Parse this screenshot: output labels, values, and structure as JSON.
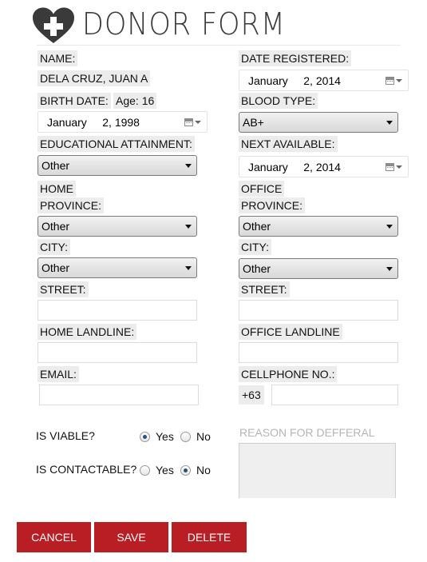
{
  "header": {
    "title": "DONOR FORM",
    "logo_icon": "heart-plus-icon",
    "accent": "#3a3a3a"
  },
  "left": {
    "name_label": "NAME:",
    "name_value": "DELA CRUZ, JUAN A",
    "birth_label": "BIRTH DATE:",
    "age_text": "Age: 16",
    "birth_date": "January     2, 1998",
    "edu_label": "EDUCATIONAL ATTAINMENT:",
    "edu_value": "Other",
    "home_label": "HOME",
    "province_label": "PROVINCE:",
    "province_value": "Other",
    "city_label": "CITY:",
    "city_value": "Other",
    "street_label": "STREET:",
    "street_value": "",
    "landline_label": "HOME LANDLINE:",
    "landline_value": "",
    "email_label": "EMAIL:",
    "email_value": ""
  },
  "right": {
    "date_registered_label": "DATE REGISTERED:",
    "date_registered": "January     2, 2014",
    "blood_type_label": "BLOOD TYPE:",
    "blood_type_value": "AB+",
    "next_available_label": "NEXT AVAILABLE:",
    "next_available": "January     2, 2014",
    "office_label": "OFFICE",
    "province_label": "PROVINCE:",
    "province_value": "Other",
    "city_label": "CITY:",
    "city_value": "Other",
    "street_label": "STREET:",
    "street_value": "",
    "landline_label": "OFFICE LANDLINE",
    "landline_value": "",
    "cellphone_label": "CELLPHONE NO.:",
    "cellphone_prefix": "+63",
    "cellphone_value": ""
  },
  "status": {
    "viable_label": "IS VIABLE?",
    "viable_yes": "Yes",
    "viable_no": "No",
    "viable_selected": "Yes",
    "contactable_label": "IS CONTACTABLE?",
    "contactable_yes": "Yes",
    "contactable_no": "No",
    "contactable_selected": "No",
    "deferral_label": "REASON FOR DEFFERAL",
    "deferral_value": ""
  },
  "buttons": {
    "cancel": "CANCEL",
    "save": "SAVE",
    "delete": "DELETE",
    "color": "#b81e24"
  }
}
